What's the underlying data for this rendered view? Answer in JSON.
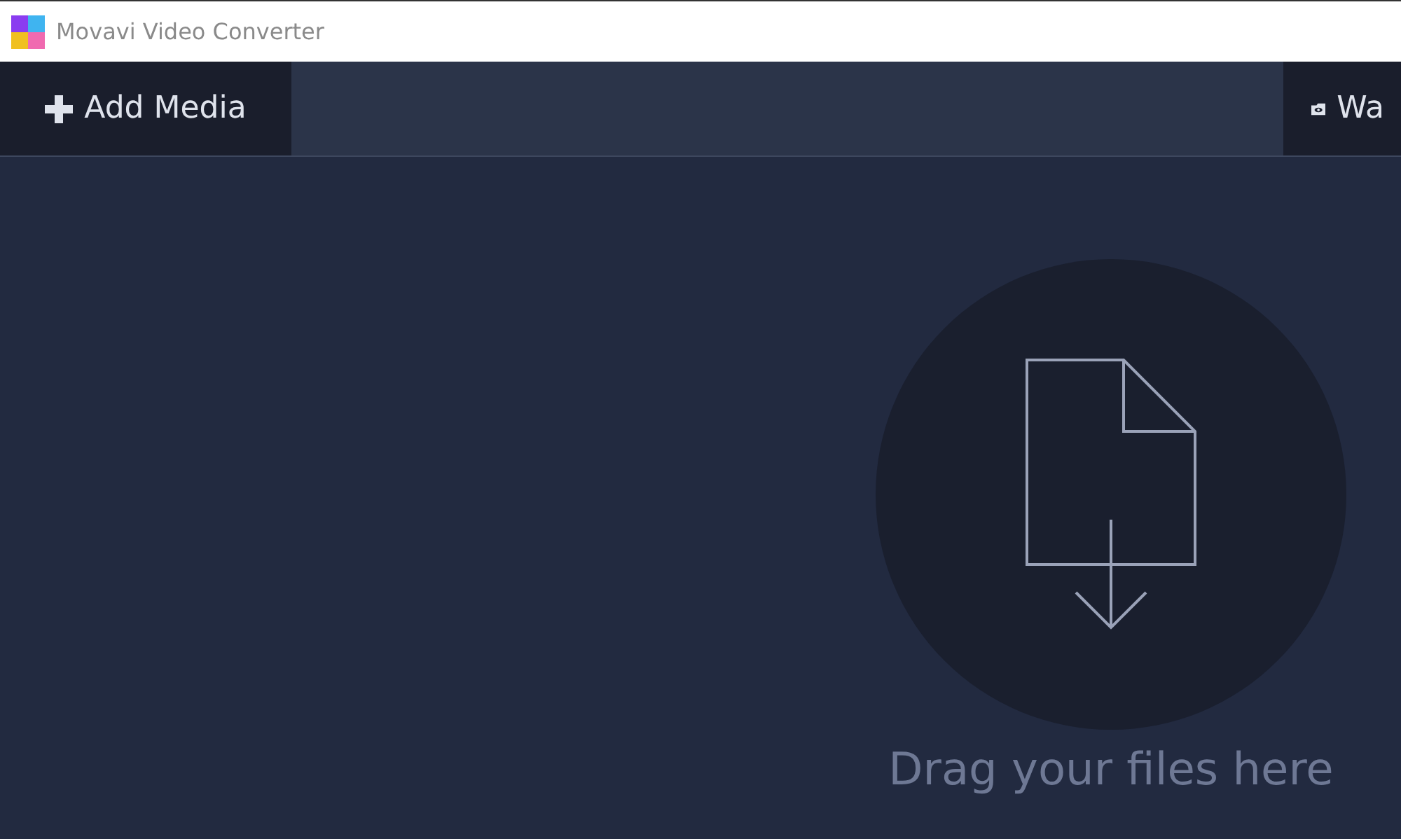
{
  "window": {
    "title": "Movavi Video Converter"
  },
  "toolbar": {
    "buttons": [
      {
        "label": "Add Media"
      },
      {
        "label": "Wa"
      }
    ]
  },
  "drop_zone": {
    "text": "Drag your files here"
  }
}
